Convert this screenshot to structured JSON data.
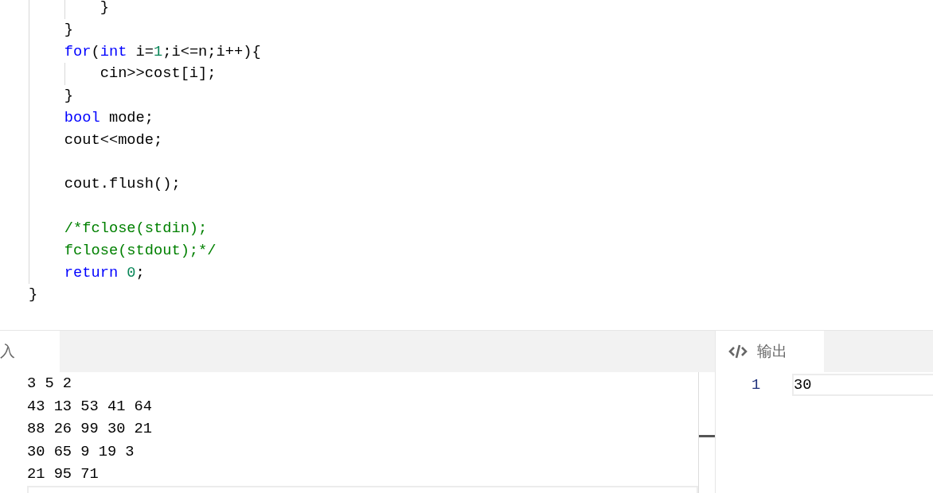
{
  "editor": {
    "lines": [
      {
        "tokens": [
          {
            "kind": "plain",
            "text": "        }"
          }
        ]
      },
      {
        "tokens": [
          {
            "kind": "plain",
            "text": "    }"
          }
        ]
      },
      {
        "tokens": [
          {
            "kind": "keyword",
            "text": "    for"
          },
          {
            "kind": "plain",
            "text": "("
          },
          {
            "kind": "keyword",
            "text": "int"
          },
          {
            "kind": "plain",
            "text": " i="
          },
          {
            "kind": "number",
            "text": "1"
          },
          {
            "kind": "plain",
            "text": ";i<=n;i++){"
          }
        ]
      },
      {
        "tokens": [
          {
            "kind": "plain",
            "text": "        cin>>cost[i];"
          }
        ]
      },
      {
        "tokens": [
          {
            "kind": "plain",
            "text": "    }"
          }
        ]
      },
      {
        "tokens": [
          {
            "kind": "keyword",
            "text": "    bool"
          },
          {
            "kind": "plain",
            "text": " mode;"
          }
        ]
      },
      {
        "tokens": [
          {
            "kind": "plain",
            "text": "    cout<<mode;"
          }
        ]
      },
      {
        "kind": "blank"
      },
      {
        "tokens": [
          {
            "kind": "plain",
            "text": "    cout.flush();"
          }
        ]
      },
      {
        "kind": "blank"
      },
      {
        "tokens": [
          {
            "kind": "comment",
            "text": "    /*fclose(stdin);"
          }
        ]
      },
      {
        "tokens": [
          {
            "kind": "comment",
            "text": "    fclose(stdout);*/"
          }
        ]
      },
      {
        "tokens": [
          {
            "kind": "keyword",
            "text": "    return "
          },
          {
            "kind": "number",
            "text": "0"
          },
          {
            "kind": "plain",
            "text": ";"
          }
        ]
      },
      {
        "tokens": [
          {
            "kind": "plain",
            "text": "}"
          }
        ]
      }
    ]
  },
  "input_panel": {
    "tab": {
      "label": "入",
      "selected": true
    },
    "lines": [
      "3 5 2",
      "43 13 53 41 64",
      "88 26 99 30 21",
      "30 65 9 19 3",
      "21 95 71"
    ]
  },
  "output_panel": {
    "tab": {
      "label": "输出",
      "selected": true
    },
    "lines": [
      {
        "number": "1",
        "text": "30"
      }
    ]
  }
}
